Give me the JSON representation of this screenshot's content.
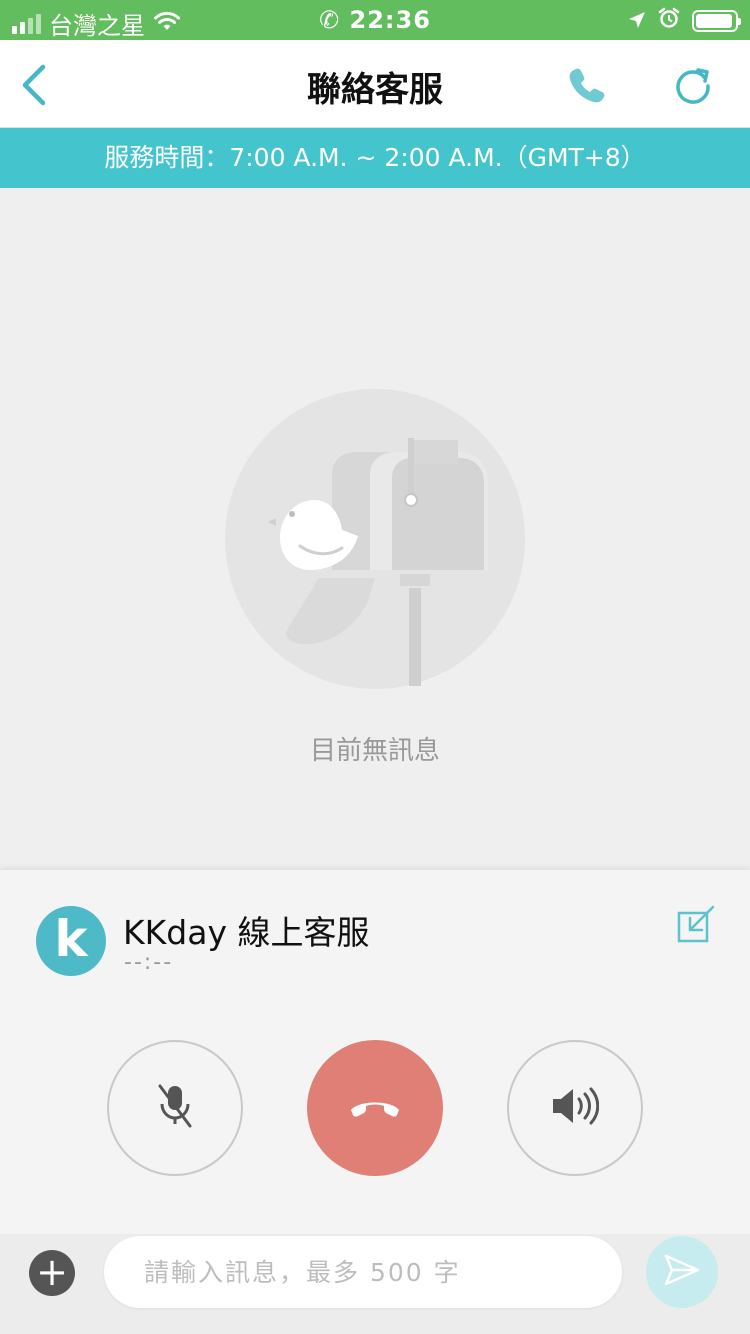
{
  "status_bar": {
    "carrier": "台灣之星",
    "time": "22:36",
    "icons": [
      "signal-icon",
      "wifi-icon",
      "call-active-icon",
      "location-arrow-icon",
      "alarm-icon",
      "battery-icon"
    ]
  },
  "nav": {
    "title": "聯絡客服",
    "icons": [
      "back-chevron-icon",
      "phone-icon",
      "refresh-icon"
    ]
  },
  "banner": {
    "text": "服務時間：7:00 A.M. ~ 2:00 A.M.（GMT+8）"
  },
  "empty_state": {
    "text": "目前無訊息",
    "icon": "mailbox-bird-illustration"
  },
  "call_panel": {
    "avatar_letter": "k",
    "agent_name": "KKday 線上客服",
    "timer": "--:--",
    "buttons": [
      "mute-icon",
      "hangup-icon",
      "speaker-icon"
    ]
  },
  "input_bar": {
    "placeholder": "請輸入訊息，最多 500 字",
    "value": ""
  },
  "colors": {
    "status_bar": "#62bd5e",
    "accent_teal": "#44c4cd",
    "hangup_red": "#e07f75",
    "send_disabled": "#c7ecef"
  }
}
